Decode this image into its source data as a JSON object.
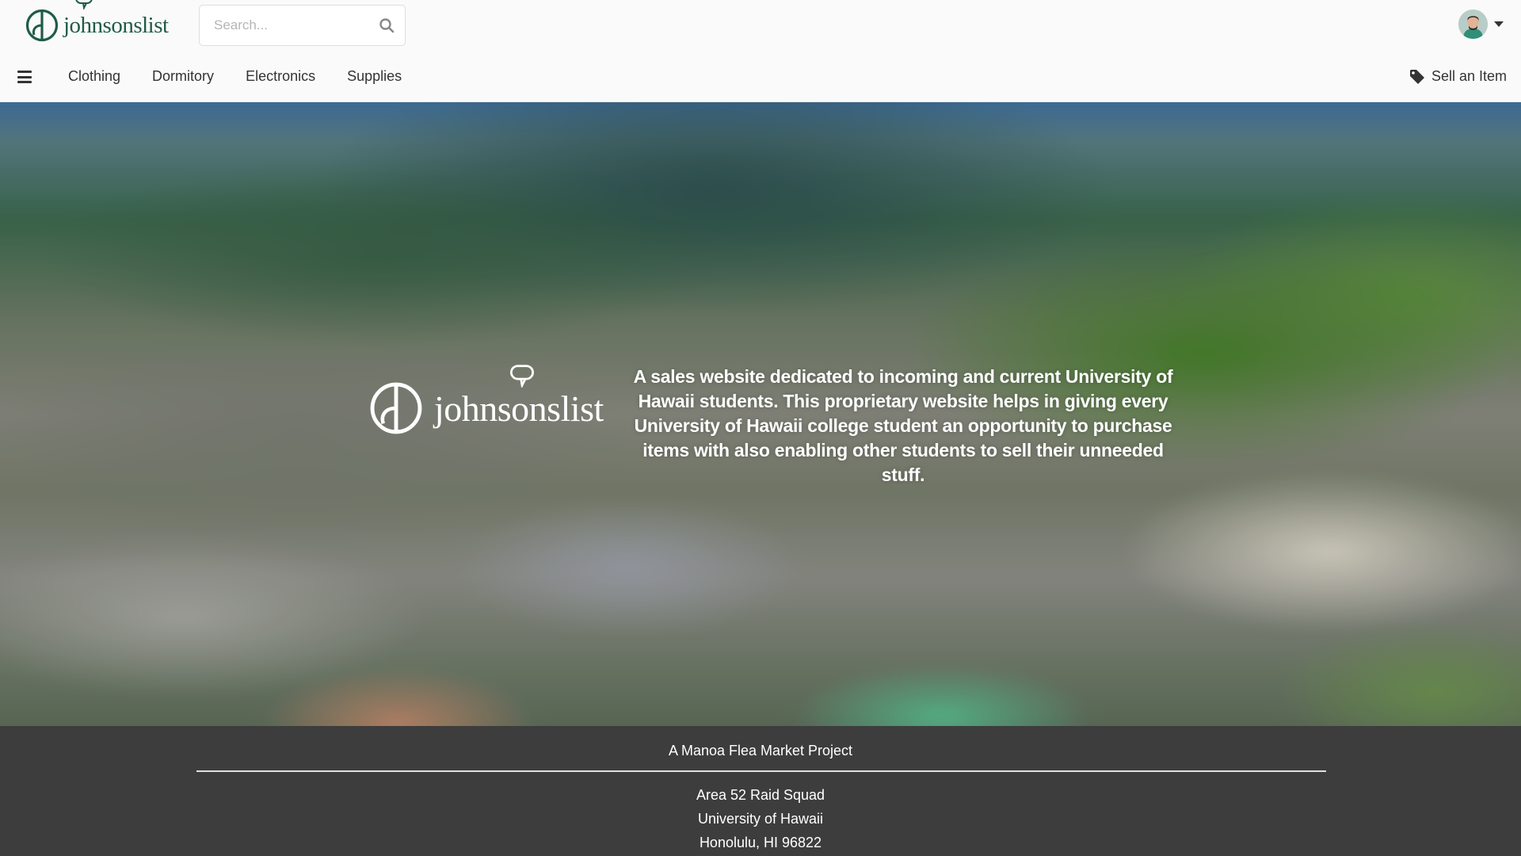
{
  "brand": {
    "name": "johnsonslist"
  },
  "search": {
    "placeholder": "Search...",
    "value": ""
  },
  "nav": {
    "menu_icon": "hamburger-icon",
    "items": [
      {
        "label": "Clothing"
      },
      {
        "label": "Dormitory"
      },
      {
        "label": "Electronics"
      },
      {
        "label": "Supplies"
      }
    ],
    "sell_label": "Sell an Item",
    "sell_icon": "tag-icon"
  },
  "user": {
    "avatar_icon": "user-avatar",
    "menu_icon": "caret-down-icon"
  },
  "hero": {
    "logo_text": "johnsonslist",
    "description": "A sales website dedicated to incoming and current University of Hawaii students. This proprietary website helps in giving every University of Hawaii college student an opportunity to purchase items with also enabling other students to sell their unneeded stuff."
  },
  "footer": {
    "title": "A Manoa Flea Market Project",
    "lines": [
      "Area 52 Raid Squad",
      "University of Hawaii",
      "Honolulu, HI 96822"
    ]
  },
  "colors": {
    "brand_green": "#1f5c45",
    "header_bg": "#fafafa",
    "footer_bg": "#3d3d3d",
    "text": "#333333"
  }
}
